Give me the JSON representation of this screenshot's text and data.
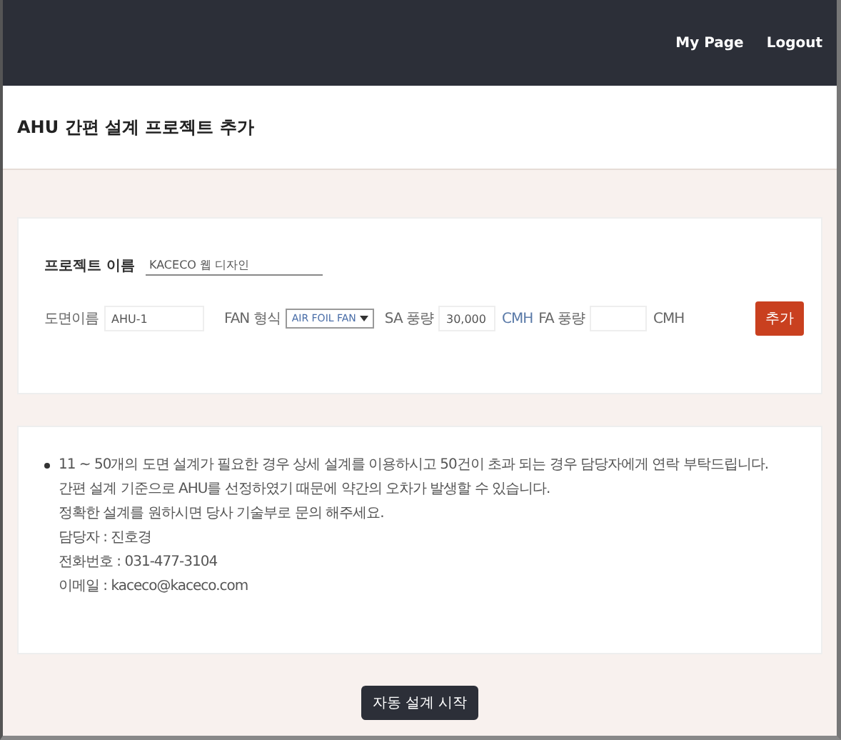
{
  "nav": {
    "links": [
      "My Page",
      "Logout"
    ]
  },
  "page_title": "AHU 간편 설계 프로젝트 추가",
  "project": {
    "label": "프로젝트 이름",
    "value": "KACECO 웹 디자인"
  },
  "form": {
    "drawing_label": "도면이름",
    "drawing_value": "AHU-1",
    "fan_label": "FAN 형식",
    "fan_value": "AIR FOIL FAN",
    "sa_label": "SA 풍량",
    "sa_value": "30,000",
    "sa_unit": "CMH",
    "fa_label": "FA 풍량",
    "fa_unit": "CMH",
    "add_button": "추가"
  },
  "notes": [
    "11 ~ 50개의 도면 설계가 필요한 경우 상세 설계를 이용하시고 50건이 초과 되는 경우 담당자에게 연락 부탁드립니다.",
    "간편 설계 기준으로 AHU를 선정하였기 때문에 약간의 오차가 발생할 수 있습니다.",
    "정확한 설계를 원하시면 당사 기술부로 문의 해주세요.",
    "담당자 : 진호경",
    "전화번호 : 031-477-3104",
    "이메일 : kaceco@kaceco.com"
  ],
  "start_button": "자동 설계 시작"
}
